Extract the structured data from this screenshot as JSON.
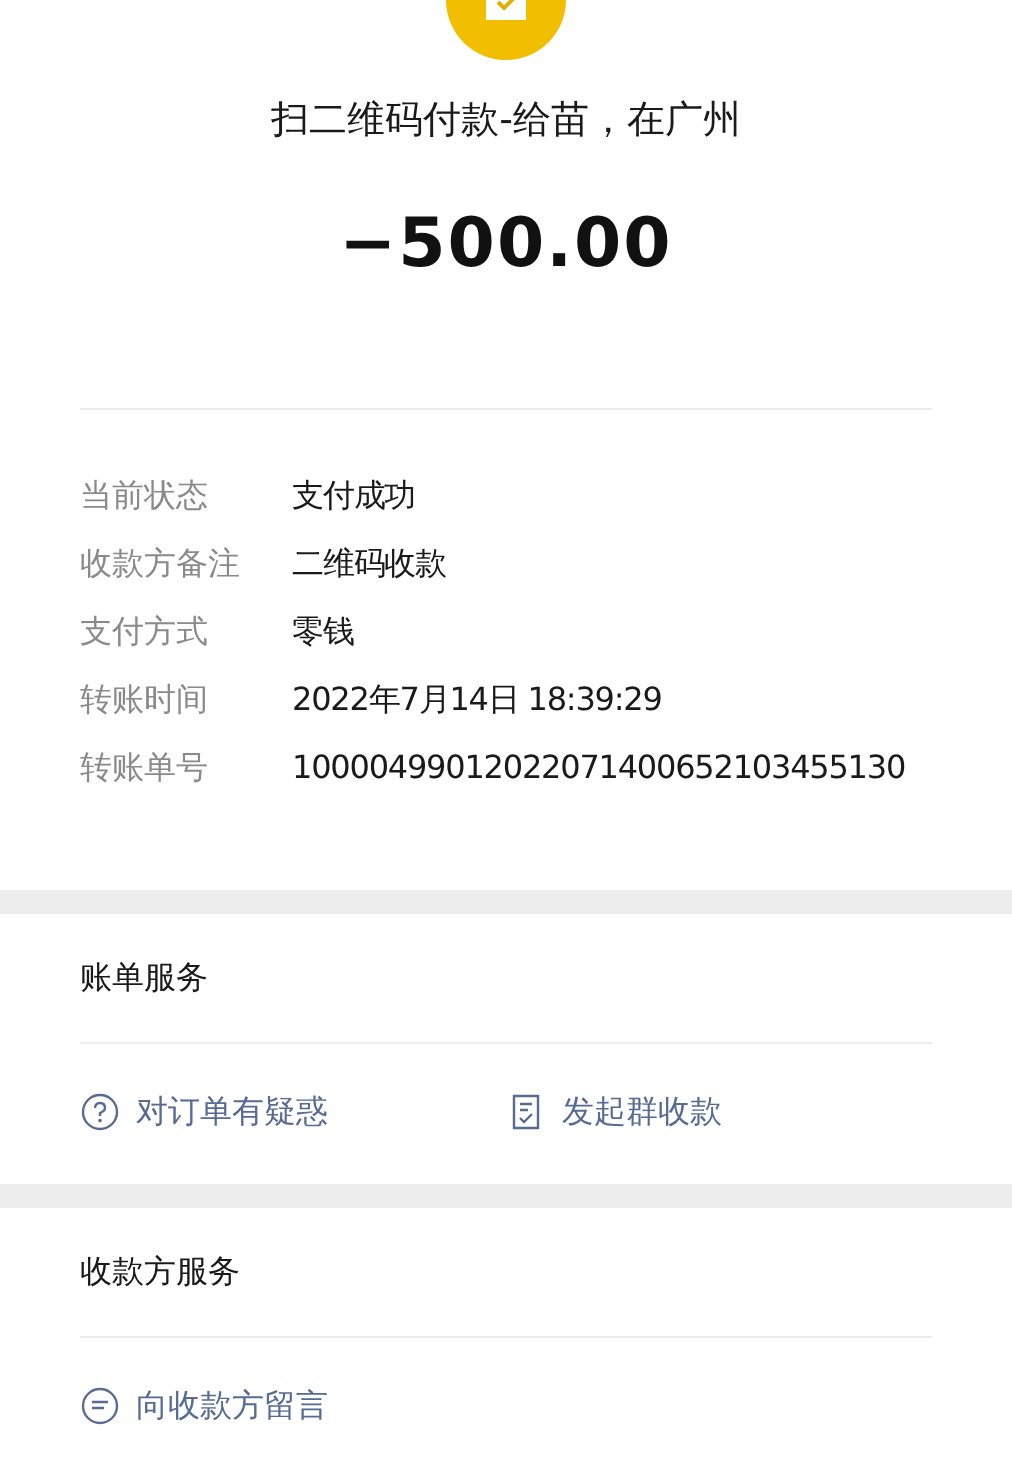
{
  "header": {
    "title": "扫二维码付款-给苗，在广州",
    "amount": "−500.00"
  },
  "details": [
    {
      "label": "当前状态",
      "value": "支付成功"
    },
    {
      "label": "收款方备注",
      "value": "二维码收款"
    },
    {
      "label": "支付方式",
      "value": "零钱"
    },
    {
      "label": "转账时间",
      "value": "2022年7月14日 18:39:29"
    },
    {
      "label": "转账单号",
      "value": "10000499012022071400652103455130"
    }
  ],
  "sections": [
    {
      "title": "账单服务",
      "actions": [
        {
          "kind": "question",
          "label": "对订单有疑惑"
        },
        {
          "kind": "receipt",
          "label": "发起群收款"
        }
      ]
    },
    {
      "title": "收款方服务",
      "actions": [
        {
          "kind": "message",
          "label": "向收款方留言"
        }
      ]
    }
  ]
}
